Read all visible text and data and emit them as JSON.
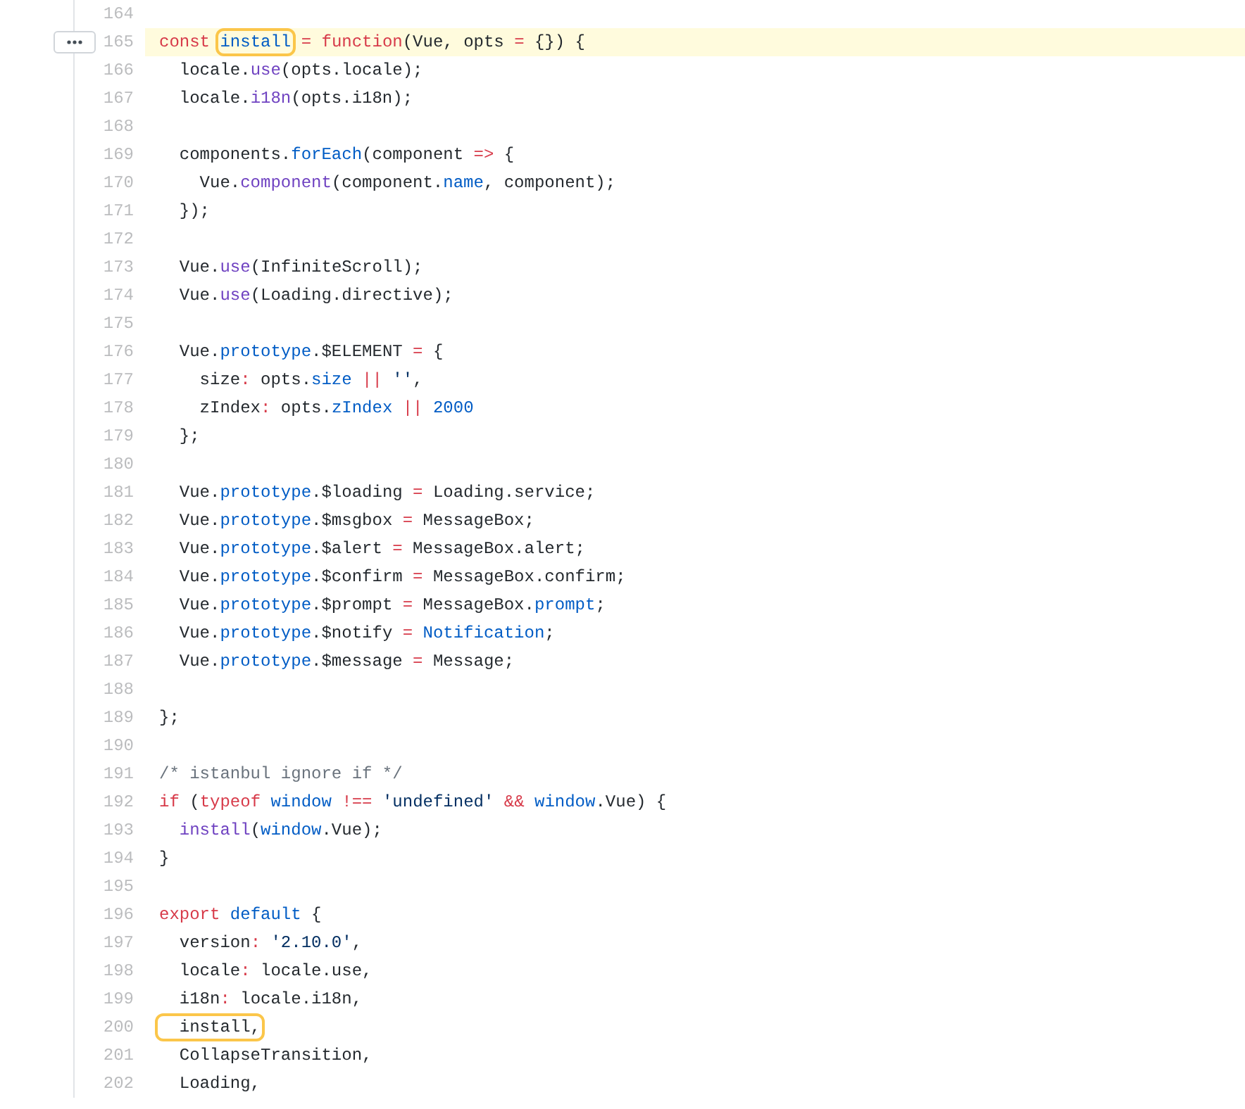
{
  "lines": [
    {
      "number": "164",
      "highlighted": false
    },
    {
      "number": "165",
      "highlighted": true,
      "tokens": [
        {
          "text": "const ",
          "kind": "kw",
          "boxed": false
        },
        {
          "text": "install",
          "kind": "const",
          "boxed": true
        },
        {
          "text": " = ",
          "kind": "kw",
          "boxed": false
        },
        {
          "text": "function",
          "kind": "kw",
          "boxed": false
        },
        {
          "text": "(Vue, opts ",
          "kind": "plain",
          "boxed": false
        },
        {
          "text": "=",
          "kind": "kw",
          "boxed": false
        },
        {
          "text": " {}) {",
          "kind": "plain",
          "boxed": false
        }
      ]
    },
    {
      "number": "166",
      "highlighted": false,
      "tokens": [
        {
          "text": "  locale.",
          "kind": "plain",
          "boxed": false
        },
        {
          "text": "use",
          "kind": "fn",
          "boxed": false
        },
        {
          "text": "(opts.locale);",
          "kind": "plain",
          "boxed": false
        }
      ]
    },
    {
      "number": "167",
      "highlighted": false,
      "tokens": [
        {
          "text": "  locale.",
          "kind": "plain",
          "boxed": false
        },
        {
          "text": "i18n",
          "kind": "fn",
          "boxed": false
        },
        {
          "text": "(opts.i18n);",
          "kind": "plain",
          "boxed": false
        }
      ]
    },
    {
      "number": "168",
      "highlighted": false
    },
    {
      "number": "169",
      "highlighted": false,
      "tokens": [
        {
          "text": "  components.",
          "kind": "plain",
          "boxed": false
        },
        {
          "text": "forEach",
          "kind": "const",
          "boxed": false
        },
        {
          "text": "(component ",
          "kind": "plain",
          "boxed": false
        },
        {
          "text": "=>",
          "kind": "kw",
          "boxed": false
        },
        {
          "text": " {",
          "kind": "plain",
          "boxed": false
        }
      ]
    },
    {
      "number": "170",
      "highlighted": false,
      "tokens": [
        {
          "text": "    Vue.",
          "kind": "plain",
          "boxed": false
        },
        {
          "text": "component",
          "kind": "fn",
          "boxed": false
        },
        {
          "text": "(component.",
          "kind": "plain",
          "boxed": false
        },
        {
          "text": "name",
          "kind": "const",
          "boxed": false
        },
        {
          "text": ", component);",
          "kind": "plain",
          "boxed": false
        }
      ]
    },
    {
      "number": "171",
      "highlighted": false,
      "tokens": [
        {
          "text": "  });",
          "kind": "plain",
          "boxed": false
        }
      ]
    },
    {
      "number": "172",
      "highlighted": false
    },
    {
      "number": "173",
      "highlighted": false,
      "tokens": [
        {
          "text": "  Vue.",
          "kind": "plain",
          "boxed": false
        },
        {
          "text": "use",
          "kind": "fn",
          "boxed": false
        },
        {
          "text": "(InfiniteScroll);",
          "kind": "plain",
          "boxed": false
        }
      ]
    },
    {
      "number": "174",
      "highlighted": false,
      "tokens": [
        {
          "text": "  Vue.",
          "kind": "plain",
          "boxed": false
        },
        {
          "text": "use",
          "kind": "fn",
          "boxed": false
        },
        {
          "text": "(Loading.directive);",
          "kind": "plain",
          "boxed": false
        }
      ]
    },
    {
      "number": "175",
      "highlighted": false
    },
    {
      "number": "176",
      "highlighted": false,
      "tokens": [
        {
          "text": "  Vue.",
          "kind": "plain",
          "boxed": false
        },
        {
          "text": "prototype",
          "kind": "const",
          "boxed": false
        },
        {
          "text": ".$ELEMENT ",
          "kind": "plain",
          "boxed": false
        },
        {
          "text": "=",
          "kind": "kw",
          "boxed": false
        },
        {
          "text": " {",
          "kind": "plain",
          "boxed": false
        }
      ]
    },
    {
      "number": "177",
      "highlighted": false,
      "tokens": [
        {
          "text": "    size",
          "kind": "plain",
          "boxed": false
        },
        {
          "text": ":",
          "kind": "kw",
          "boxed": false
        },
        {
          "text": " opts.",
          "kind": "plain",
          "boxed": false
        },
        {
          "text": "size",
          "kind": "const",
          "boxed": false
        },
        {
          "text": " || ",
          "kind": "kw",
          "boxed": false
        },
        {
          "text": "''",
          "kind": "str",
          "boxed": false
        },
        {
          "text": ",",
          "kind": "plain",
          "boxed": false
        }
      ]
    },
    {
      "number": "178",
      "highlighted": false,
      "tokens": [
        {
          "text": "    zIndex",
          "kind": "plain",
          "boxed": false
        },
        {
          "text": ":",
          "kind": "kw",
          "boxed": false
        },
        {
          "text": " opts.",
          "kind": "plain",
          "boxed": false
        },
        {
          "text": "zIndex",
          "kind": "const",
          "boxed": false
        },
        {
          "text": " || ",
          "kind": "kw",
          "boxed": false
        },
        {
          "text": "2000",
          "kind": "const",
          "boxed": false
        }
      ]
    },
    {
      "number": "179",
      "highlighted": false,
      "tokens": [
        {
          "text": "  };",
          "kind": "plain",
          "boxed": false
        }
      ]
    },
    {
      "number": "180",
      "highlighted": false
    },
    {
      "number": "181",
      "highlighted": false,
      "tokens": [
        {
          "text": "  Vue.",
          "kind": "plain",
          "boxed": false
        },
        {
          "text": "prototype",
          "kind": "const",
          "boxed": false
        },
        {
          "text": ".$loading ",
          "kind": "plain",
          "boxed": false
        },
        {
          "text": "=",
          "kind": "kw",
          "boxed": false
        },
        {
          "text": " Loading.service;",
          "kind": "plain",
          "boxed": false
        }
      ]
    },
    {
      "number": "182",
      "highlighted": false,
      "tokens": [
        {
          "text": "  Vue.",
          "kind": "plain",
          "boxed": false
        },
        {
          "text": "prototype",
          "kind": "const",
          "boxed": false
        },
        {
          "text": ".$msgbox ",
          "kind": "plain",
          "boxed": false
        },
        {
          "text": "=",
          "kind": "kw",
          "boxed": false
        },
        {
          "text": " MessageBox;",
          "kind": "plain",
          "boxed": false
        }
      ]
    },
    {
      "number": "183",
      "highlighted": false,
      "tokens": [
        {
          "text": "  Vue.",
          "kind": "plain",
          "boxed": false
        },
        {
          "text": "prototype",
          "kind": "const",
          "boxed": false
        },
        {
          "text": ".$alert ",
          "kind": "plain",
          "boxed": false
        },
        {
          "text": "=",
          "kind": "kw",
          "boxed": false
        },
        {
          "text": " MessageBox.alert;",
          "kind": "plain",
          "boxed": false
        }
      ]
    },
    {
      "number": "184",
      "highlighted": false,
      "tokens": [
        {
          "text": "  Vue.",
          "kind": "plain",
          "boxed": false
        },
        {
          "text": "prototype",
          "kind": "const",
          "boxed": false
        },
        {
          "text": ".$confirm ",
          "kind": "plain",
          "boxed": false
        },
        {
          "text": "=",
          "kind": "kw",
          "boxed": false
        },
        {
          "text": " MessageBox.confirm;",
          "kind": "plain",
          "boxed": false
        }
      ]
    },
    {
      "number": "185",
      "highlighted": false,
      "tokens": [
        {
          "text": "  Vue.",
          "kind": "plain",
          "boxed": false
        },
        {
          "text": "prototype",
          "kind": "const",
          "boxed": false
        },
        {
          "text": ".$prompt ",
          "kind": "plain",
          "boxed": false
        },
        {
          "text": "=",
          "kind": "kw",
          "boxed": false
        },
        {
          "text": " MessageBox.",
          "kind": "plain",
          "boxed": false
        },
        {
          "text": "prompt",
          "kind": "const",
          "boxed": false
        },
        {
          "text": ";",
          "kind": "plain",
          "boxed": false
        }
      ]
    },
    {
      "number": "186",
      "highlighted": false,
      "tokens": [
        {
          "text": "  Vue.",
          "kind": "plain",
          "boxed": false
        },
        {
          "text": "prototype",
          "kind": "const",
          "boxed": false
        },
        {
          "text": ".$notify ",
          "kind": "plain",
          "boxed": false
        },
        {
          "text": "=",
          "kind": "kw",
          "boxed": false
        },
        {
          "text": " Notification",
          "kind": "const",
          "boxed": false
        },
        {
          "text": ";",
          "kind": "plain",
          "boxed": false
        }
      ]
    },
    {
      "number": "187",
      "highlighted": false,
      "tokens": [
        {
          "text": "  Vue.",
          "kind": "plain",
          "boxed": false
        },
        {
          "text": "prototype",
          "kind": "const",
          "boxed": false
        },
        {
          "text": ".$message ",
          "kind": "plain",
          "boxed": false
        },
        {
          "text": "=",
          "kind": "kw",
          "boxed": false
        },
        {
          "text": " Message;",
          "kind": "plain",
          "boxed": false
        }
      ]
    },
    {
      "number": "188",
      "highlighted": false
    },
    {
      "number": "189",
      "highlighted": false,
      "tokens": [
        {
          "text": "};",
          "kind": "plain",
          "boxed": false
        }
      ]
    },
    {
      "number": "190",
      "highlighted": false
    },
    {
      "number": "191",
      "highlighted": false,
      "tokens": [
        {
          "text": "/* istanbul ignore if */",
          "kind": "comment",
          "boxed": false
        }
      ]
    },
    {
      "number": "192",
      "highlighted": false,
      "tokens": [
        {
          "text": "if",
          "kind": "kw",
          "boxed": false
        },
        {
          "text": " (",
          "kind": "plain",
          "boxed": false
        },
        {
          "text": "typeof ",
          "kind": "kw",
          "boxed": false
        },
        {
          "text": "window",
          "kind": "const",
          "boxed": false
        },
        {
          "text": " !== ",
          "kind": "kw",
          "boxed": false
        },
        {
          "text": "'undefined'",
          "kind": "str",
          "boxed": false
        },
        {
          "text": " && ",
          "kind": "kw",
          "boxed": false
        },
        {
          "text": "window",
          "kind": "const",
          "boxed": false
        },
        {
          "text": ".Vue) {",
          "kind": "plain",
          "boxed": false
        }
      ]
    },
    {
      "number": "193",
      "highlighted": false,
      "tokens": [
        {
          "text": "  install",
          "kind": "fn",
          "boxed": false
        },
        {
          "text": "(",
          "kind": "plain",
          "boxed": false
        },
        {
          "text": "window",
          "kind": "const",
          "boxed": false
        },
        {
          "text": ".Vue);",
          "kind": "plain",
          "boxed": false
        }
      ]
    },
    {
      "number": "194",
      "highlighted": false,
      "tokens": [
        {
          "text": "}",
          "kind": "plain",
          "boxed": false
        }
      ]
    },
    {
      "number": "195",
      "highlighted": false
    },
    {
      "number": "196",
      "highlighted": false,
      "tokens": [
        {
          "text": "export ",
          "kind": "kw",
          "boxed": false
        },
        {
          "text": "default",
          "kind": "const",
          "boxed": false
        },
        {
          "text": " {",
          "kind": "plain",
          "boxed": false
        }
      ]
    },
    {
      "number": "197",
      "highlighted": false,
      "tokens": [
        {
          "text": "  version",
          "kind": "plain",
          "boxed": false
        },
        {
          "text": ": ",
          "kind": "kw",
          "boxed": false
        },
        {
          "text": "'2.10.0'",
          "kind": "str",
          "boxed": false
        },
        {
          "text": ",",
          "kind": "plain",
          "boxed": false
        }
      ]
    },
    {
      "number": "198",
      "highlighted": false,
      "tokens": [
        {
          "text": "  locale",
          "kind": "plain",
          "boxed": false
        },
        {
          "text": ":",
          "kind": "kw",
          "boxed": false
        },
        {
          "text": " locale.use,",
          "kind": "plain",
          "boxed": false
        }
      ]
    },
    {
      "number": "199",
      "highlighted": false,
      "tokens": [
        {
          "text": "  i18n",
          "kind": "plain",
          "boxed": false
        },
        {
          "text": ":",
          "kind": "kw",
          "boxed": false
        },
        {
          "text": " locale.i18n,",
          "kind": "plain",
          "boxed": false
        }
      ]
    },
    {
      "number": "200",
      "highlighted": false,
      "tokens": [
        {
          "text": "  install,",
          "kind": "plain",
          "boxed": true
        }
      ]
    },
    {
      "number": "201",
      "highlighted": false,
      "tokens": [
        {
          "text": "  CollapseTransition,",
          "kind": "plain",
          "boxed": false
        }
      ]
    },
    {
      "number": "202",
      "highlighted": false,
      "tokens": [
        {
          "text": "  Loading,",
          "kind": "plain",
          "boxed": false
        }
      ]
    }
  ]
}
